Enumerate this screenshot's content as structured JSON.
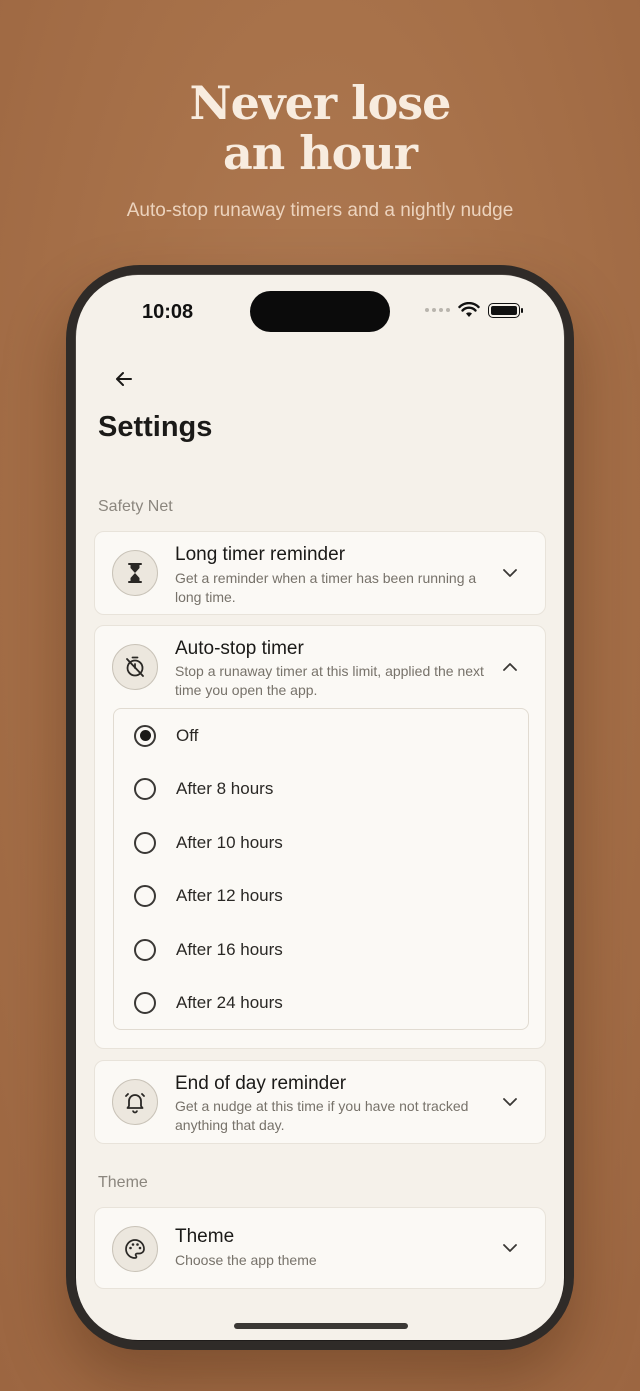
{
  "hero": {
    "title": "Never lose\nan hour",
    "subtitle": "Auto-stop runaway timers and a nightly nudge"
  },
  "status_bar": {
    "time": "10:08"
  },
  "page": {
    "title": "Settings"
  },
  "sections": {
    "safety_net": "Safety Net",
    "theme": "Theme"
  },
  "cards": {
    "long_timer": {
      "title": "Long timer reminder",
      "description": "Get a reminder when a timer has been running a long time.",
      "icon": "hourglass-icon"
    },
    "auto_stop": {
      "title": "Auto-stop timer",
      "description": "Stop a runaway timer at this limit, applied the next time you open the app.",
      "icon": "timer-off-icon",
      "selected": "Off",
      "options": [
        "Off",
        "After 8 hours",
        "After 10 hours",
        "After 12 hours",
        "After 16 hours",
        "After 24 hours"
      ]
    },
    "end_of_day": {
      "title": "End of day reminder",
      "description": "Get a nudge at this time if you have not tracked anything that day.",
      "icon": "bell-icon"
    },
    "theme": {
      "title": "Theme",
      "description": "Choose the app theme",
      "icon": "palette-icon"
    }
  },
  "colors": {
    "background": "#a8724a",
    "screen": "#f5f1ea",
    "text_primary": "#1b1a18"
  }
}
